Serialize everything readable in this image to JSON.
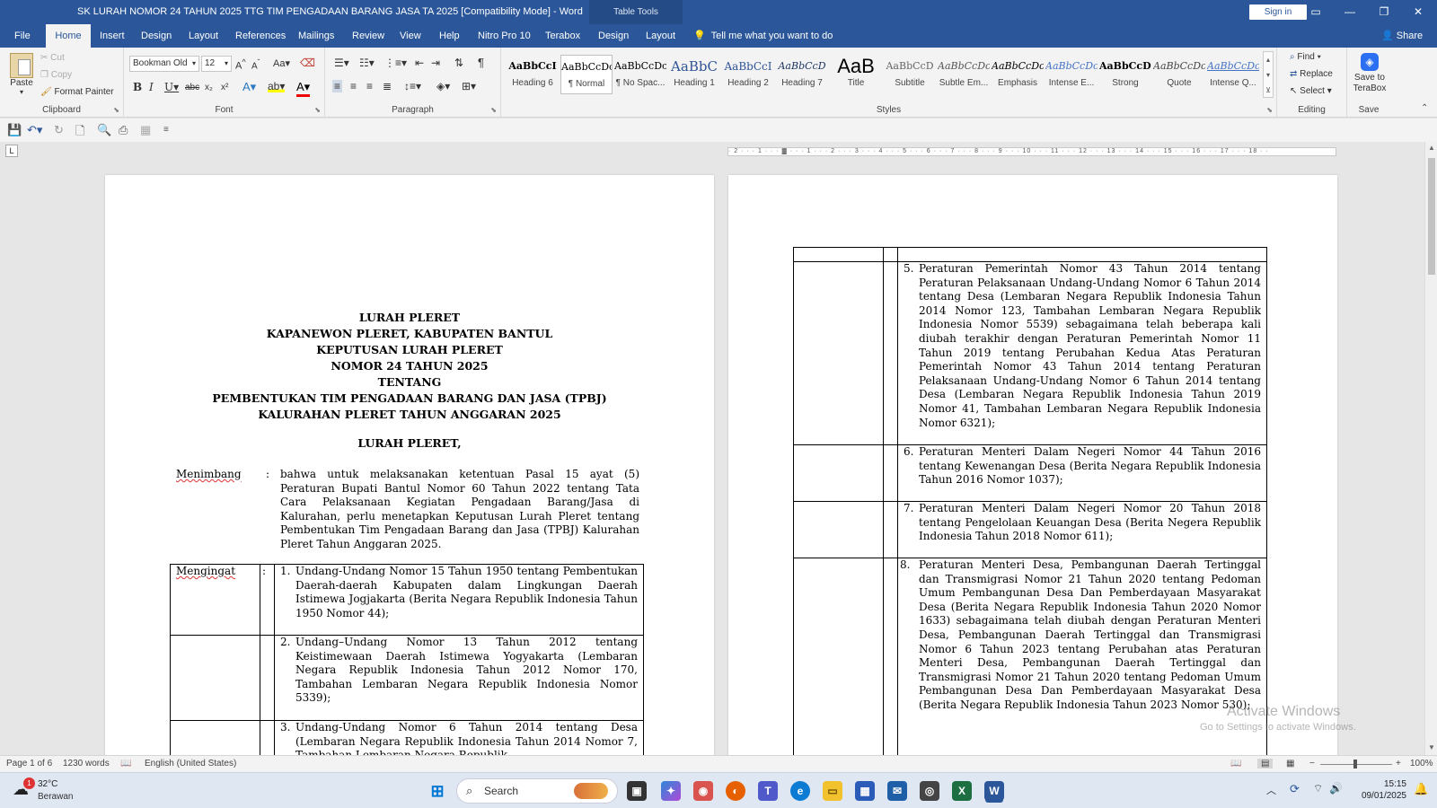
{
  "titlebar": {
    "title": "SK LURAH NOMOR 24 TAHUN 2025 TTG TIM PENGADAAN BARANG JASA TA 2025 [Compatibility Mode]  -  Word",
    "table_tools": "Table Tools",
    "sign_in": "Sign in"
  },
  "tabs": [
    "File",
    "Home",
    "Insert",
    "Design",
    "Layout",
    "References",
    "Mailings",
    "Review",
    "View",
    "Help",
    "Nitro Pro 10",
    "Terabox",
    "Design",
    "Layout"
  ],
  "tell_me": "Tell me what you want to do",
  "share": "Share",
  "ribbon": {
    "clipboard": {
      "label": "Clipboard",
      "paste": "Paste",
      "cut": "Cut",
      "copy": "Copy",
      "format_painter": "Format Painter"
    },
    "font": {
      "label": "Font",
      "font_name": "Bookman Old",
      "font_size": "12"
    },
    "paragraph": {
      "label": "Paragraph"
    },
    "styles": {
      "label": "Styles",
      "items": [
        {
          "preview": "AaBbCcI",
          "name": "Heading 6"
        },
        {
          "preview": "AaBbCcDc",
          "name": "¶ Normal"
        },
        {
          "preview": "AaBbCcDc",
          "name": "¶ No Spac..."
        },
        {
          "preview": "AaBbC",
          "name": "Heading 1"
        },
        {
          "preview": "AaBbCcI",
          "name": "Heading 2"
        },
        {
          "preview": "AaBbCcD",
          "name": "Heading 7"
        },
        {
          "preview": "AaB",
          "name": "Title"
        },
        {
          "preview": "AaBbCcD",
          "name": "Subtitle"
        },
        {
          "preview": "AaBbCcDc",
          "name": "Subtle Em..."
        },
        {
          "preview": "AaBbCcDc",
          "name": "Emphasis"
        },
        {
          "preview": "AaBbCcDc",
          "name": "Intense E..."
        },
        {
          "preview": "AaBbCcDc",
          "name": "Strong"
        },
        {
          "preview": "AaBbCcDc",
          "name": "Quote"
        },
        {
          "preview": "AaBbCcDc",
          "name": "Intense Q..."
        }
      ]
    },
    "editing": {
      "label": "Editing",
      "find": "Find",
      "replace": "Replace",
      "select": "Select"
    },
    "save": {
      "label": "Save",
      "save_to": "Save to",
      "terabox": "TeraBox"
    }
  },
  "ruler_text": "· 2 · · · 1 · · · ▓ · · · 1 · · · 2 · · · 3 · · · 4 · · · 5 · · · 6 · · · 7 · · · 8 · · · 9 · · · 10 · · · 11 · · · 12 · · · 13 · · · 14 · · · 15 · · · 16 · · · 17 · · · 18 · ·",
  "page1": {
    "heading_lines": [
      "LURAH PLERET",
      "KAPANEWON PLERET, KABUPATEN BANTUL",
      "KEPUTUSAN LURAH PLERET",
      "NOMOR 24 TAHUN 2025",
      "TENTANG",
      "PEMBENTUKAN TIM PENGADAAN BARANG DAN JASA (TPBJ)",
      "KALURAHAN PLERET TAHUN ANGGARAN 2025"
    ],
    "subheading": "LURAH PLERET,",
    "menimbang_label": "Menimbang",
    "colon": ":",
    "menimbang_text": "bahwa untuk melaksanakan ketentuan Pasal 15 ayat (5) Peraturan Bupati Bantul Nomor 60 Tahun 2022 tentang Tata Cara Pelaksanaan Kegiatan Pengadaan Barang/Jasa di Kalurahan, perlu menetapkan Keputusan Lurah Pleret tentang Pembentukan Tim Pengadaan Barang dan Jasa (TPBJ) Kalurahan Pleret Tahun Anggaran 2025.",
    "mengingat_label": "Mengingat",
    "items": [
      {
        "num": "1.",
        "text": "Undang-Undang Nomor 15 Tahun 1950 tentang Pembentukan Daerah-daerah Kabupaten dalam Lingkungan Daerah Istimewa Jogjakarta (Berita Negara Republik Indonesia Tahun 1950 Nomor 44);"
      },
      {
        "num": "2.",
        "text": "Undang–Undang Nomor 13 Tahun 2012 tentang Keistimewaan Daerah Istimewa Yogyakarta (Lembaran Negara Republik Indonesia Tahun 2012 Nomor 170, Tambahan Lembaran Negara Republik Indonesia Nomor 5339);"
      },
      {
        "num": "3.",
        "text": "Undang-Undang Nomor 6 Tahun 2014 tentang Desa (Lembaran Negara Republik Indonesia Tahun 2014 Nomor 7, Tambahan Lembaran Negara Republik"
      }
    ]
  },
  "page2": {
    "items": [
      {
        "num": "5.",
        "text": "Peraturan Pemerintah Nomor 43 Tahun 2014 tentang Peraturan Pelaksanaan Undang-Undang Nomor 6 Tahun 2014 tentang Desa (Lembaran Negara Republik Indonesia Tahun 2014 Nomor 123, Tambahan Lembaran Negara Republik Indonesia Nomor 5539) sebagaimana telah beberapa kali diubah terakhir dengan Peraturan Pemerintah Nomor 11 Tahun 2019 tentang Perubahan Kedua Atas Peraturan Pemerintah Nomor 43 Tahun 2014 tentang Peraturan Pelaksanaan Undang-Undang Nomor 6 Tahun 2014 tentang Desa (Lembaran Negara Republik Indonesia Tahun 2019 Nomor 41, Tambahan Lembaran Negara Republik Indonesia Nomor 6321);"
      },
      {
        "num": "6.",
        "text": "Peraturan Menteri Dalam Negeri Nomor 44 Tahun 2016 tentang Kewenangan Desa (Berita Negara Republik Indonesia Tahun 2016 Nomor 1037);"
      },
      {
        "num": "7.",
        "text": "Peraturan Menteri Dalam Negeri Nomor 20 Tahun 2018 tentang Pengelolaan Keuangan Desa (Berita Negera Republik Indonesia Tahun 2018 Nomor 611);"
      },
      {
        "num": "8.",
        "text": "Peraturan Menteri Desa, Pembangunan Daerah Tertinggal dan Transmigrasi Nomor 21 Tahun 2020 tentang Pedoman Umum Pembangunan Desa Dan Pemberdayaan Masyarakat Desa (Berita Negara Republik Indonesia Tahun 2020 Nomor 1633) sebagaimana telah diubah dengan Peraturan Menteri Desa, Pembangunan Daerah Tertinggal dan Transmigrasi Nomor 6 Tahun 2023 tentang Perubahan atas Peraturan Menteri Desa, Pembangunan Daerah Tertinggal dan Transmigrasi Nomor 21 Tahun 2020 tentang Pedoman Umum Pembangunan Desa Dan Pemberdayaan Masyarakat Desa (Berita Negara Republik Indonesia Tahun 2023 Nomor 530);"
      }
    ]
  },
  "watermark": {
    "line1": "Activate Windows",
    "line2": "Go to Settings to activate Windows."
  },
  "statusbar": {
    "page": "Page 1 of 6",
    "words": "1230 words",
    "language": "English (United States)",
    "zoom": "100%"
  },
  "taskbar": {
    "temperature": "32°C",
    "weather": "Berawan",
    "search_placeholder": "Search",
    "time": "15:15",
    "date": "09/01/2025",
    "notification_count": "1"
  },
  "colors": {
    "word_blue": "#2b579a",
    "excel_green": "#1d6f42"
  }
}
